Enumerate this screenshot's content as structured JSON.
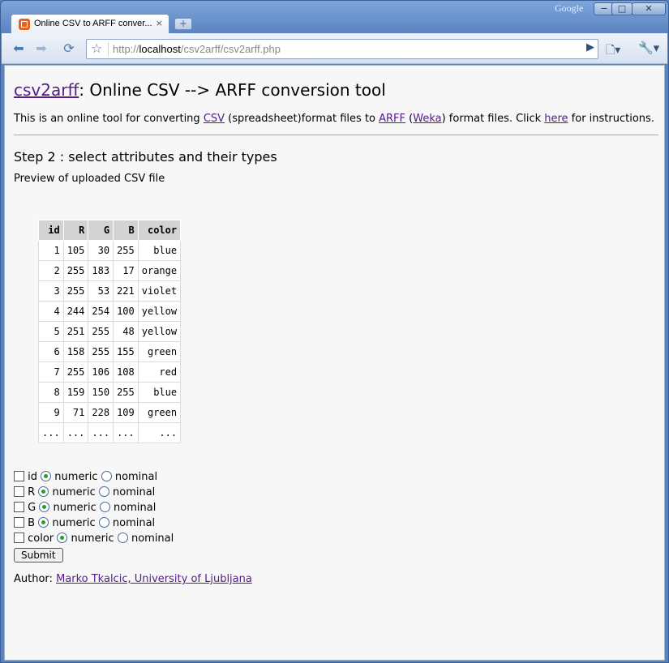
{
  "browser": {
    "tab_title": "Online CSV to ARFF conver...",
    "tab_close": "×",
    "new_tab": "+",
    "brand": "Google",
    "minimize": "−",
    "maximize": "□",
    "close": "✕",
    "url_prefix": "http://",
    "url_host": "localhost",
    "url_path": "/csv2arff/csv2arff.php"
  },
  "header": {
    "link": "csv2arff",
    "title_rest": ": Online CSV --> ARFF conversion tool"
  },
  "intro": {
    "t1": "This is an online tool for converting ",
    "csv_link": "CSV",
    "t2": " (spreadsheet)format files to ",
    "arff_link": "ARFF",
    "t3": " (",
    "weka_link": "Weka",
    "t4": ") format files. Click ",
    "here_link": "here",
    "t5": " for instructions."
  },
  "step": {
    "heading": "Step 2 : select attributes and their types",
    "preview_label": "Preview of uploaded CSV file"
  },
  "table": {
    "headers": [
      "id",
      "R",
      "G",
      "B",
      "color"
    ],
    "rows": [
      [
        "1",
        "105",
        "30",
        "255",
        "blue"
      ],
      [
        "2",
        "255",
        "183",
        "17",
        "orange"
      ],
      [
        "3",
        "255",
        "53",
        "221",
        "violet"
      ],
      [
        "4",
        "244",
        "254",
        "100",
        "yellow"
      ],
      [
        "5",
        "251",
        "255",
        "48",
        "yellow"
      ],
      [
        "6",
        "158",
        "255",
        "155",
        "green"
      ],
      [
        "7",
        "255",
        "106",
        "108",
        "red"
      ],
      [
        "8",
        "159",
        "150",
        "255",
        "blue"
      ],
      [
        "9",
        "71",
        "228",
        "109",
        "green"
      ],
      [
        "...",
        "...",
        "...",
        "...",
        "..."
      ]
    ]
  },
  "attributes": [
    {
      "name": "id",
      "numeric": "numeric",
      "nominal": "nominal"
    },
    {
      "name": "R",
      "numeric": "numeric",
      "nominal": "nominal"
    },
    {
      "name": "G",
      "numeric": "numeric",
      "nominal": "nominal"
    },
    {
      "name": "B",
      "numeric": "numeric",
      "nominal": "nominal"
    },
    {
      "name": "color",
      "numeric": "numeric",
      "nominal": "nominal"
    }
  ],
  "form": {
    "submit_label": "Submit"
  },
  "author": {
    "label": "Author: ",
    "link": "Marko Tkalcic, University of Ljubljana"
  }
}
